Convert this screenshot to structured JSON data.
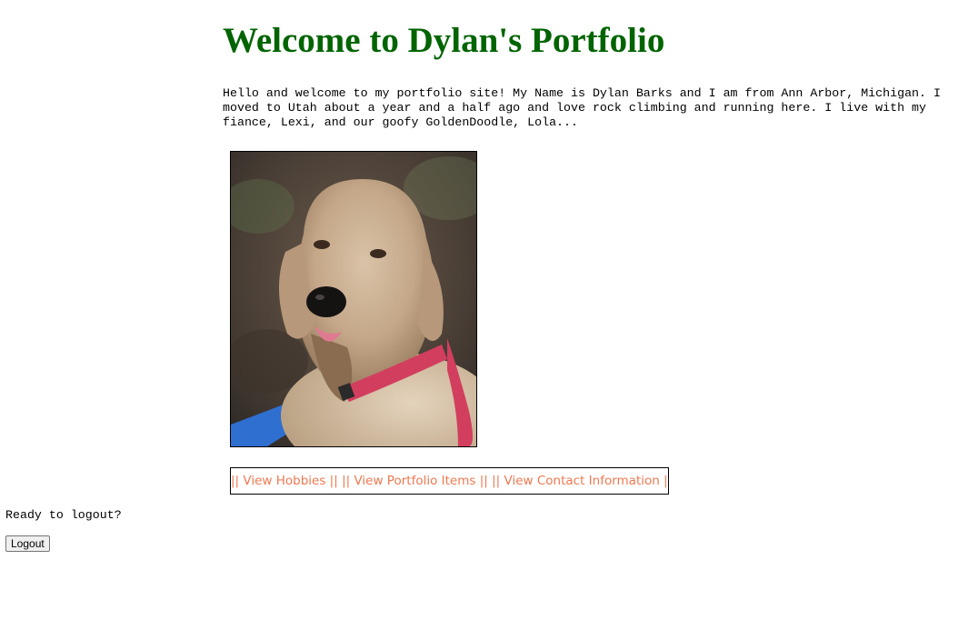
{
  "header": {
    "title": "Welcome to Dylan's Portfolio",
    "title_color": "#006400"
  },
  "intro": {
    "text": "Hello and welcome to my portfolio site! My Name is Dylan Barks and I am from Ann Arbor, Michigan. I moved to Utah about a year and a half ago and love rock climbing and running here. I live with my fiance, Lexi, and our goofy GoldenDoodle, Lola..."
  },
  "photo": {
    "subject": "golden doodle dog with pink harness"
  },
  "nav": {
    "link_color": "#f07850",
    "separator": "||",
    "items": [
      {
        "label": "View Hobbies"
      },
      {
        "label": "View Portfolio Items"
      },
      {
        "label": "View Contact Information"
      }
    ]
  },
  "logout": {
    "prompt": "Ready to logout?",
    "button_label": "Logout"
  }
}
